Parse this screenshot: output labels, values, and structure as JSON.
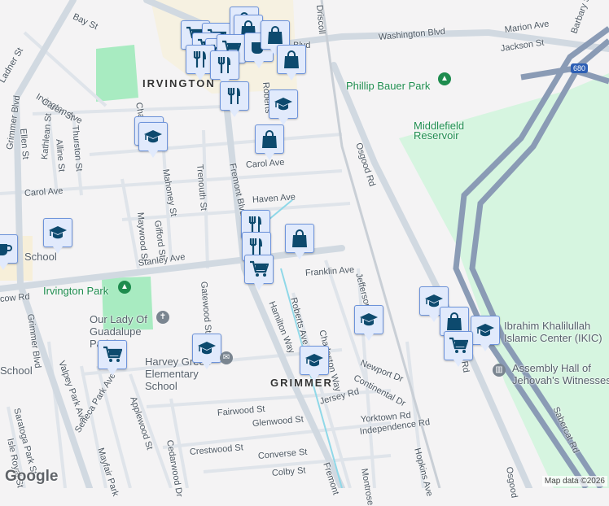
{
  "map": {
    "neighborhoods": [
      "IRVINGTON",
      "GRIMMER"
    ],
    "streets": [
      "Bay St",
      "Washington Blvd",
      "Marion Ave",
      "Jackson St",
      "Barbary St",
      "Osgood Rd",
      "Irvington Ave",
      "Caren St",
      "Ladner St",
      "Grimmer Blvd",
      "Ellen St",
      "Kathlean St",
      "Alline St",
      "Thurston St",
      "Carol Ave",
      "Carol Ave",
      "Haven Ave",
      "Chap",
      "Mahoney St",
      "Trenouth St",
      "Fremont Blvd",
      "Roberts",
      "Maywood St",
      "Gifford St",
      "Stanley Ave",
      "Franklin Ave",
      "Jefferson St",
      "cow Rd",
      "Grimmer Blvd",
      "Gatewood St",
      "Hamilton Way",
      "Roberts Ave",
      "Charleston Way",
      "Newport Dr",
      "Continental Dr",
      "Jersey Rd",
      "Yorktown Rd",
      "Independence Rd",
      "Fairwood St",
      "Glenwood St",
      "Crestwood St",
      "Converse St",
      "Colby St",
      "Valpey Park Ave",
      "Seneca Park Ave",
      "Applewood St",
      "Cedarwood Dr",
      "Mayfair Park",
      "Saratoga Park St",
      "Isle Royal St",
      "Sabercat Rd",
      "Hopkins Ave",
      "Montrose",
      "Fremont",
      "Osgood",
      "Driscoll",
      "Blvd",
      "Rd"
    ],
    "parks": [
      "Phillip Bauer Park",
      "Middlefield Reservoir",
      "Irvington Park"
    ],
    "places": [
      "Our Lady Of Guadalupe Parish",
      "Harvey Green Elementary School",
      "Ibrahim Khalilullah Islamic Center (IKIC)",
      "Assembly Hall of Jehovah's Witnesses",
      "School",
      "School"
    ],
    "highway_shield": "680",
    "attribution": "Map data ©2026",
    "logo": "Google"
  },
  "markers": [
    "cart-icon",
    "cart-icon",
    "bag-icon",
    "bag-icon",
    "cart-icon",
    "cart-icon",
    "cart-icon",
    "coffee-icon",
    "bag-icon",
    "restaurant-icon",
    "restaurant-icon",
    "restaurant-icon",
    "bag-icon",
    "school-icon",
    "bag-icon",
    "school-icon",
    "school-icon",
    "school-icon",
    "coffee-icon",
    "restaurant-icon",
    "restaurant-icon",
    "cart-icon",
    "bag-icon",
    "school-icon",
    "school-icon",
    "bag-icon",
    "school-icon",
    "cart-icon",
    "school-icon",
    "school-icon",
    "cart-icon"
  ],
  "colors": {
    "marker_bg": "#e1eafc",
    "marker_border": "#6d93da",
    "marker_icon": "#0d4a6e",
    "park": "#a8ebc1",
    "highway": "#8a9bb5",
    "road": "#d4dce4"
  }
}
